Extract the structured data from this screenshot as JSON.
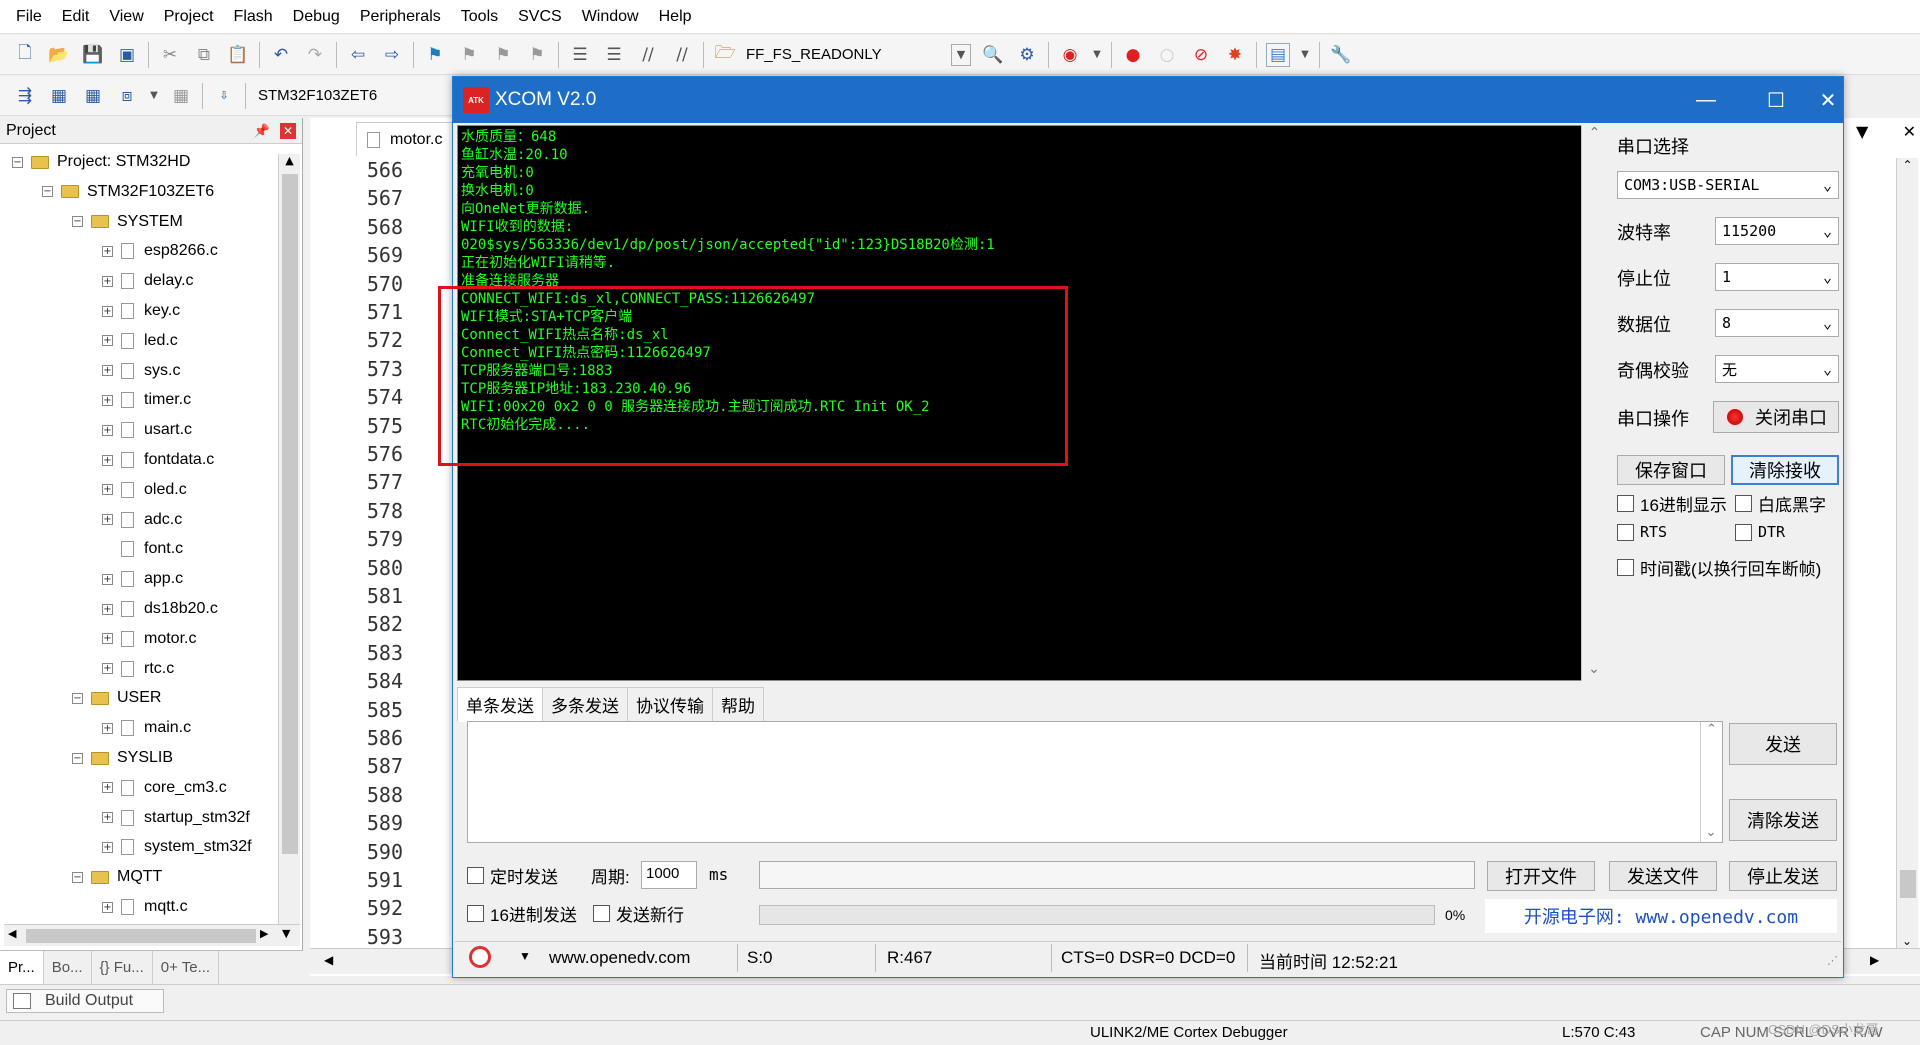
{
  "menu": [
    "File",
    "Edit",
    "View",
    "Project",
    "Flash",
    "Debug",
    "Peripherals",
    "Tools",
    "SVCS",
    "Window",
    "Help"
  ],
  "toolbar": {
    "combo_value": "FF_FS_READONLY",
    "target_value": "STM32F103ZET6"
  },
  "project": {
    "title": "Project",
    "root": "Project: STM32HD",
    "target": "STM32F103ZET6",
    "groups": [
      {
        "name": "SYSTEM",
        "files": [
          "esp8266.c",
          "delay.c",
          "key.c",
          "led.c",
          "sys.c",
          "timer.c",
          "usart.c",
          "fontdata.c",
          "oled.c",
          "adc.c",
          "font.c",
          "app.c",
          "ds18b20.c",
          "motor.c",
          "rtc.c"
        ]
      },
      {
        "name": "USER",
        "files": [
          "main.c"
        ]
      },
      {
        "name": "SYSLIB",
        "files": [
          "core_cm3.c",
          "startup_stm32f",
          "system_stm32f"
        ]
      },
      {
        "name": "MQTT",
        "files": [
          "mqtt.c"
        ]
      }
    ],
    "tabs": [
      "Pr...",
      "Bo...",
      "{} Fu...",
      "0+ Te..."
    ]
  },
  "editor": {
    "tab": "motor.c",
    "lines": [
      "566",
      "567",
      "568",
      "569",
      "570",
      "571",
      "572",
      "573",
      "574",
      "575",
      "576",
      "577",
      "578",
      "579",
      "580",
      "581",
      "582",
      "583",
      "584",
      "585",
      "586",
      "587",
      "588",
      "589",
      "590",
      "591",
      "592",
      "593"
    ]
  },
  "xcom": {
    "title": "XCOM V2.0",
    "receive_lines": [
      "水质质量：648",
      "鱼缸水温:20.10",
      "充氧电机:0",
      "换水电机:0",
      "向OneNet更新数据.",
      "WIFI收到的数据:",
      "020$sys/563336/dev1/dp/post/json/accepted{\"id\":123}DS18B20检测:1",
      "正在初始化WIFI请稍等.",
      "准备连接服务器",
      "CONNECT_WIFI:ds_xl,CONNECT_PASS:1126626497",
      "WIFI模式:STA+TCP客户端",
      "Connect_WIFI热点名称:ds_xl",
      "Connect_WIFI热点密码:1126626497",
      "TCP服务器端口号:1883",
      "TCP服务器IP地址:183.230.40.96",
      "WIFI:00x20 0x2 0 0 服务器连接成功.主题订阅成功.RTC Init OK_2",
      "RTC初始化完成...."
    ],
    "port_label": "串口选择",
    "port_value": "COM3:USB-SERIAL",
    "baud_label": "波特率",
    "baud_value": "115200",
    "stop_label": "停止位",
    "stop_value": "1",
    "data_label": "数据位",
    "data_value": "8",
    "parity_label": "奇偶校验",
    "parity_value": "无",
    "op_label": "串口操作",
    "close_btn": "关闭串口",
    "save_btn": "保存窗口",
    "clear_recv_btn": "清除接收",
    "hex_display": "16进制显示",
    "white_black": "白底黑字",
    "rts": "RTS",
    "dtr": "DTR",
    "timestamp": "时间戳(以换行回车断帧)",
    "tabs": [
      "单条发送",
      "多条发送",
      "协议传输",
      "帮助"
    ],
    "send_btn": "发送",
    "clear_send_btn": "清除发送",
    "timed_send": "定时发送",
    "period_label": "周期:",
    "period_value": "1000",
    "ms": "ms",
    "open_file_btn": "打开文件",
    "send_file_btn": "发送文件",
    "stop_send_btn": "停止发送",
    "hex_send": "16进制发送",
    "newline": "发送新行",
    "progress_pct": "0%",
    "progress_fraction": 0,
    "site_banner": "开源电子网: www.openedv.com",
    "status": {
      "url": "www.openedv.com",
      "s": "S:0",
      "r": "R:467",
      "lines": "CTS=0 DSR=0 DCD=0",
      "time": "当前时间 12:52:21"
    }
  },
  "build": {
    "label": "Build Output"
  },
  "statusbar": {
    "debugger": "ULINK2/ME Cortex Debugger",
    "pos": "L:570 C:43",
    "caps": "CAP  NUM  SCRL  OVR  R/W",
    "watermark": "CSDN @DS小龙哥"
  }
}
